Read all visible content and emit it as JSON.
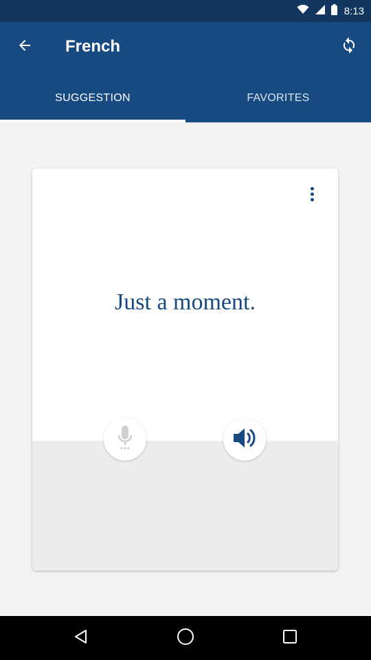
{
  "status_bar": {
    "time": "8:13",
    "icons": [
      "wifi-icon",
      "signal-icon",
      "battery-icon"
    ]
  },
  "app_bar": {
    "title": "French",
    "back_icon": "arrow-back-icon",
    "refresh_icon": "refresh-icon"
  },
  "tabs": [
    {
      "label": "SUGGESTION",
      "selected": true
    },
    {
      "label": "FAVORITES",
      "selected": false
    }
  ],
  "card": {
    "message": "Just a moment.",
    "menu_icon": "more-vert-icon",
    "mic_icon": "microphone-icon",
    "speaker_icon": "speaker-icon"
  },
  "nav_bar": {
    "icons": [
      "nav-back-icon",
      "home-icon",
      "recents-icon"
    ]
  },
  "colors": {
    "app_bar": "#174a80",
    "status_bar": "#11365f",
    "accent_text": "#174a80",
    "background": "#f2f2f2"
  }
}
